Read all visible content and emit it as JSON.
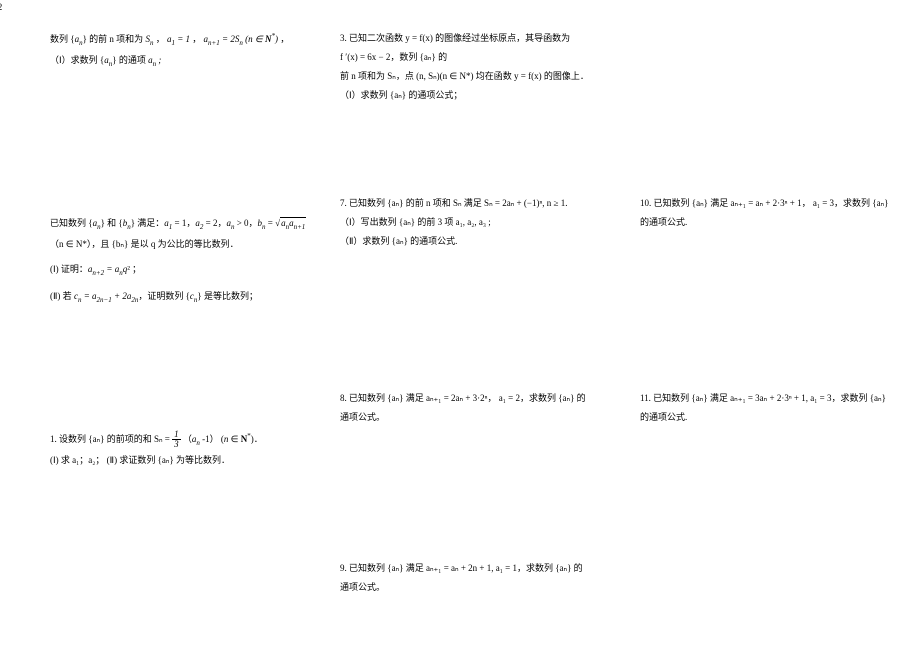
{
  "page_number": "2",
  "left_col": {
    "p1": {
      "l1a": "数列 ",
      "l1b": " 的前 n 项和为 ",
      "l1c": "，",
      "l1d": "，",
      "l1e": "，",
      "l2": "（Ⅰ）求数列 ",
      "l2b": " 的通项 ",
      "seq_an": "aₙ",
      "Sn": "Sₙ",
      "a1_eq": "a₁ = 1",
      "rec": "aₙ₊₁ = 2Sₙ (n ∈ N*)",
      "an_sym": "aₙ ;"
    },
    "p2": {
      "l1": "已知数列 {aₙ} 和 {bₙ} 满足：a₁ = 1，a₂ = 2，aₙ > 0，bₙ = ",
      "sqrt": "aₙaₙ₊₁",
      "l2": "（n ∈ N*），且 {bₙ} 是以 q 为公比的等比数列．",
      "l3": "(Ⅰ) 证明：aₙ₊₂ = aₙq² ；",
      "l4": "(Ⅱ) 若 cₙ = a₂ₙ₋₁ + 2a₂ₙ，证明数列 {cₙ} 是等比数列；"
    },
    "p3": {
      "l1a": "1.  设数列 {aₙ} 的前项的和 Sₙ = ",
      "frac_num": "1",
      "frac_den": "3",
      "l1b": "（aₙ -1）  (n ∈ N*)．",
      "l2": "(Ⅰ) 求 a₁；a₂；    (Ⅱ) 求证数列 {aₙ} 为等比数列．"
    }
  },
  "mid_col": {
    "p3": {
      "l1": "3.  已知二次函数  y = f(x) 的图像经过坐标原点，其导函数为",
      "l2": "f ′(x) = 6x − 2，数列 {aₙ} 的",
      "l3": "前 n 项和为 Sₙ，点 (n, Sₙ)(n ∈ N*) 均在函数 y = f(x) 的图像上．",
      "l4": "（Ⅰ）求数列 {aₙ} 的通项公式；"
    },
    "p7": {
      "l1": "7.  已知数列 {aₙ} 的前 n 项和 Sₙ 满足 Sₙ = 2aₙ + (−1)ⁿ, n ≥ 1.",
      "l2": "（Ⅰ）写出数列 {aₙ} 的前 3 项 a₁, a₂, a₃ ;",
      "l3": "（Ⅱ）求数列 {aₙ} 的通项公式."
    },
    "p8": {
      "l1": "8.  已知数列 {aₙ} 满足 aₙ₊₁ = 2aₙ + 3·2ⁿ， a₁ = 2，求数列 {aₙ} 的",
      "l2": "通项公式。"
    },
    "p9": {
      "l1": "9.  已知数列 {aₙ} 满足 aₙ₊₁ = aₙ + 2n + 1, a₁ = 1，求数列 {aₙ} 的",
      "l2": "通项公式。"
    }
  },
  "right_col": {
    "p10": {
      "l1": "10. 已知数列 {aₙ} 满足 aₙ₊₁ = aₙ + 2·3ⁿ + 1， a₁ = 3，求数列 {aₙ}",
      "l2": "的通项公式."
    },
    "p11": {
      "l1": "11. 已知数列 {aₙ} 满足 aₙ₊₁ = 3aₙ + 2·3ⁿ + 1,  a₁ = 3，求数列 {aₙ}",
      "l2": "的通项公式."
    }
  }
}
